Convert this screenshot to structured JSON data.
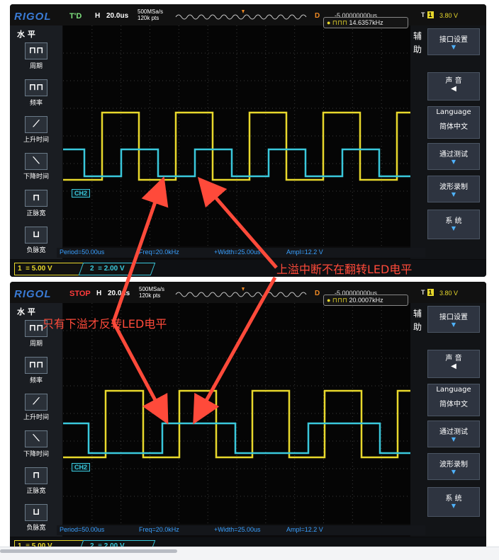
{
  "screens": [
    {
      "id": "top",
      "brand": "RIGOL",
      "run_state": "T'D",
      "run_state_color": "#7ee07e",
      "h_label": "H",
      "timebase": "20.0us",
      "sample_rate": "500MSa/s",
      "points": "120k pts",
      "d_label": "D",
      "delay": "-5.00000000us",
      "trigger_label": "T",
      "trigger_ch": "1",
      "trigger_level": "3.80 V",
      "freq_readout": "14.6357kHz",
      "left_panel_title": "水 平",
      "left_items": [
        "周期",
        "频率",
        "上升时间",
        "下降时间",
        "正脉宽",
        "负脉宽"
      ],
      "side_label": "辅助",
      "right_buttons": [
        {
          "label": "接口设置",
          "icon": "chevron-down-icon"
        },
        {
          "label": "声 音",
          "icon": "speaker-icon"
        },
        {
          "label": "Language",
          "sub": "简体中文"
        },
        {
          "label": "通过测试",
          "icon": "chevron-down-icon"
        },
        {
          "label": "波形录制",
          "icon": "chevron-down-icon"
        },
        {
          "label": "系 统",
          "icon": "chevron-down-icon"
        }
      ],
      "measurements": {
        "period": "Period=50.00us",
        "freq": "Freq=20.0kHz",
        "width": "+Width=25.00us",
        "ampl": "Ampl=12.2 V"
      },
      "ch1_scale": "5.00 V",
      "ch2_scale": "2.00 V",
      "ch2_tag": "CH2"
    },
    {
      "id": "bottom",
      "brand": "RIGOL",
      "run_state": "STOP",
      "run_state_color": "#ff3b3b",
      "h_label": "H",
      "timebase": "20.0us",
      "sample_rate": "500MSa/s",
      "points": "120k pts",
      "d_label": "D",
      "delay": "-5.00000000us",
      "trigger_label": "T",
      "trigger_ch": "1",
      "trigger_level": "3.80 V",
      "freq_readout": "20.0007kHz",
      "left_panel_title": "水 平",
      "left_items": [
        "周期",
        "频率",
        "上升时间",
        "下降时间",
        "正脉宽",
        "负脉宽"
      ],
      "side_label": "辅助",
      "right_buttons": [
        {
          "label": "接口设置",
          "icon": "chevron-down-icon"
        },
        {
          "label": "声 音",
          "icon": "speaker-icon"
        },
        {
          "label": "Language",
          "sub": "简体中文"
        },
        {
          "label": "通过测试",
          "icon": "chevron-down-icon"
        },
        {
          "label": "波形录制",
          "icon": "chevron-down-icon"
        },
        {
          "label": "系 统",
          "icon": "chevron-down-icon"
        }
      ],
      "measurements": {
        "period": "Period=50.00us",
        "freq": "Freq=20.0kHz",
        "width": "+Width=25.00us",
        "ampl": "Ampl=12.2 V"
      },
      "ch1_scale": "5.00 V",
      "ch2_scale": "2.00 V",
      "ch2_tag": "CH2"
    }
  ],
  "annotations": {
    "top_note": "上溢中断不在翻转LED电平",
    "bottom_note": "只有下溢才反转LED电平",
    "color": "#ff4a3a"
  },
  "colors": {
    "ch1": "#e8d82c",
    "ch2": "#3ac8dc"
  }
}
